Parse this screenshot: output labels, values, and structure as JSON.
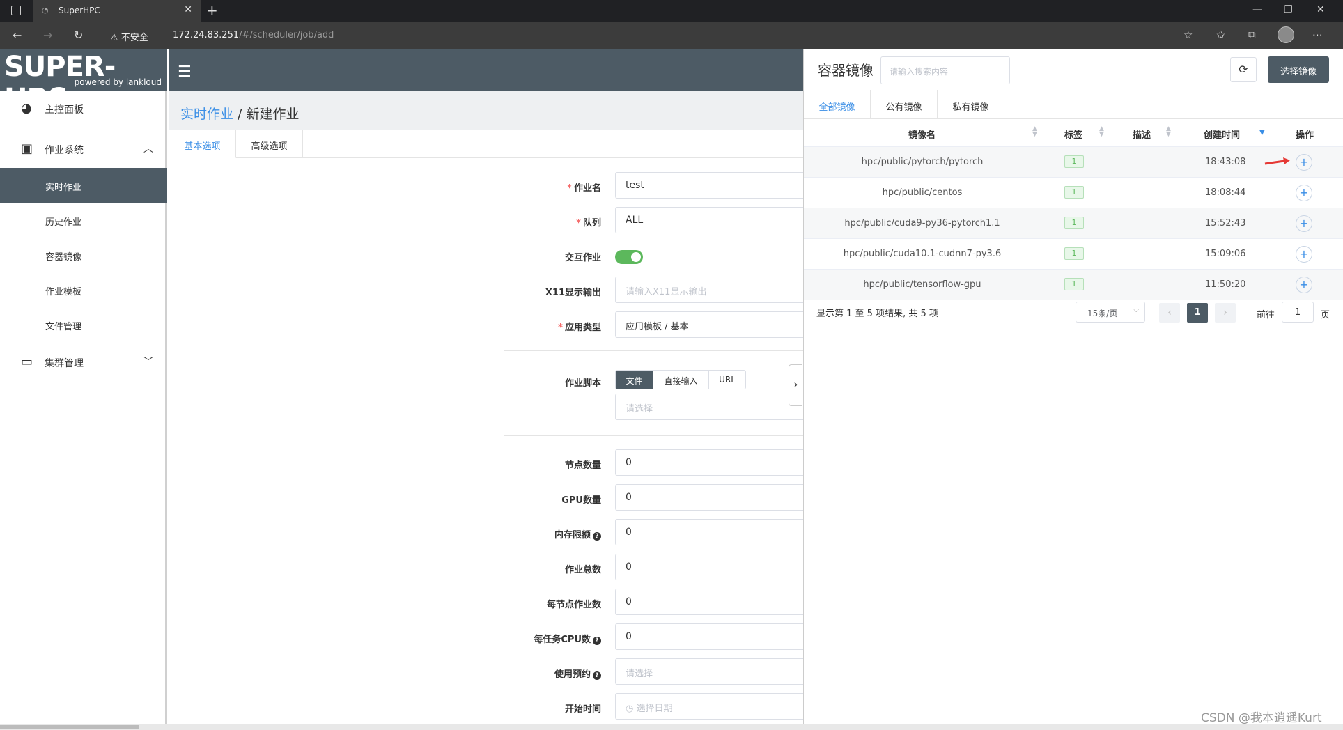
{
  "browser": {
    "tab_title": "SuperHPC",
    "insecure_label": "不安全",
    "url_host": "172.24.83.251",
    "url_path": "/#/scheduler/job/add"
  },
  "logo": {
    "main": "SUPER-HPC",
    "sub": "powered by lankloud"
  },
  "sidebar": {
    "items": [
      {
        "label": "主控面板",
        "icon": "dashboard-icon"
      },
      {
        "label": "作业系统",
        "icon": "clipboard-icon",
        "expanded": true
      },
      {
        "label": "集群管理",
        "icon": "monitor-icon",
        "expanded": false
      }
    ],
    "sub_items": [
      {
        "label": "实时作业",
        "active": true
      },
      {
        "label": "历史作业"
      },
      {
        "label": "容器镜像"
      },
      {
        "label": "作业模板"
      },
      {
        "label": "文件管理"
      }
    ]
  },
  "breadcrumb": {
    "parent": "实时作业",
    "separator": " / ",
    "current": "新建作业"
  },
  "form_tabs": [
    "基本选项",
    "高级选项"
  ],
  "form": {
    "job_name": {
      "label": "作业名",
      "value": "test"
    },
    "queue": {
      "label": "队列",
      "value": "ALL"
    },
    "interactive": {
      "label": "交互作业",
      "on": true
    },
    "x11": {
      "label": "X11显示输出",
      "placeholder": "请输入X11显示输出"
    },
    "app_type": {
      "label": "应用类型",
      "value": "应用模板 / 基本"
    },
    "script": {
      "label": "作业脚本",
      "options": [
        "文件",
        "直接输入",
        "URL"
      ],
      "selected": "文件",
      "placeholder": "请选择"
    },
    "nodes": {
      "label": "节点数量",
      "value": "0"
    },
    "gpus": {
      "label": "GPU数量",
      "value": "0"
    },
    "memory": {
      "label": "内存限额",
      "value": "0"
    },
    "total_jobs": {
      "label": "作业总数",
      "value": "0"
    },
    "jobs_per_node": {
      "label": "每节点作业数",
      "value": "0"
    },
    "cpus_per_task": {
      "label": "每任务CPU数",
      "value": "0"
    },
    "reservation": {
      "label": "使用预约",
      "placeholder": "请选择"
    },
    "start_time": {
      "label": "开始时间",
      "placeholder": "选择日期"
    }
  },
  "panel": {
    "title": "容器镜像",
    "search_placeholder": "请输入搜索内容",
    "choose_label": "选择镜像",
    "tabs": [
      "全部镜像",
      "公有镜像",
      "私有镜像"
    ],
    "columns": [
      "镜像名",
      "标签",
      "描述",
      "创建时间",
      "操作"
    ],
    "rows": [
      {
        "name": "hpc/public/pytorch/pytorch",
        "tag": "1",
        "desc": "",
        "time": "18:43:08"
      },
      {
        "name": "hpc/public/centos",
        "tag": "1",
        "desc": "",
        "time": "18:08:44"
      },
      {
        "name": "hpc/public/cuda9-py36-pytorch1.1",
        "tag": "1",
        "desc": "",
        "time": "15:52:43"
      },
      {
        "name": "hpc/public/cuda10.1-cudnn7-py3.6",
        "tag": "1",
        "desc": "",
        "time": "15:09:06"
      },
      {
        "name": "hpc/public/tensorflow-gpu",
        "tag": "1",
        "desc": "",
        "time": "11:50:20"
      }
    ],
    "pager": {
      "summary": "显示第 1 至 5 项结果, 共 5 项",
      "page_size": "15条/页",
      "current_page": "1",
      "goto_prefix": "前往",
      "goto_value": "1",
      "goto_suffix": "页"
    }
  },
  "watermark": "CSDN @我本逍遥Kurt",
  "colors": {
    "header": "#4d5b65",
    "link": "#3a8ee6",
    "switch_on": "#5cb85c",
    "required": "#f56c6c"
  }
}
